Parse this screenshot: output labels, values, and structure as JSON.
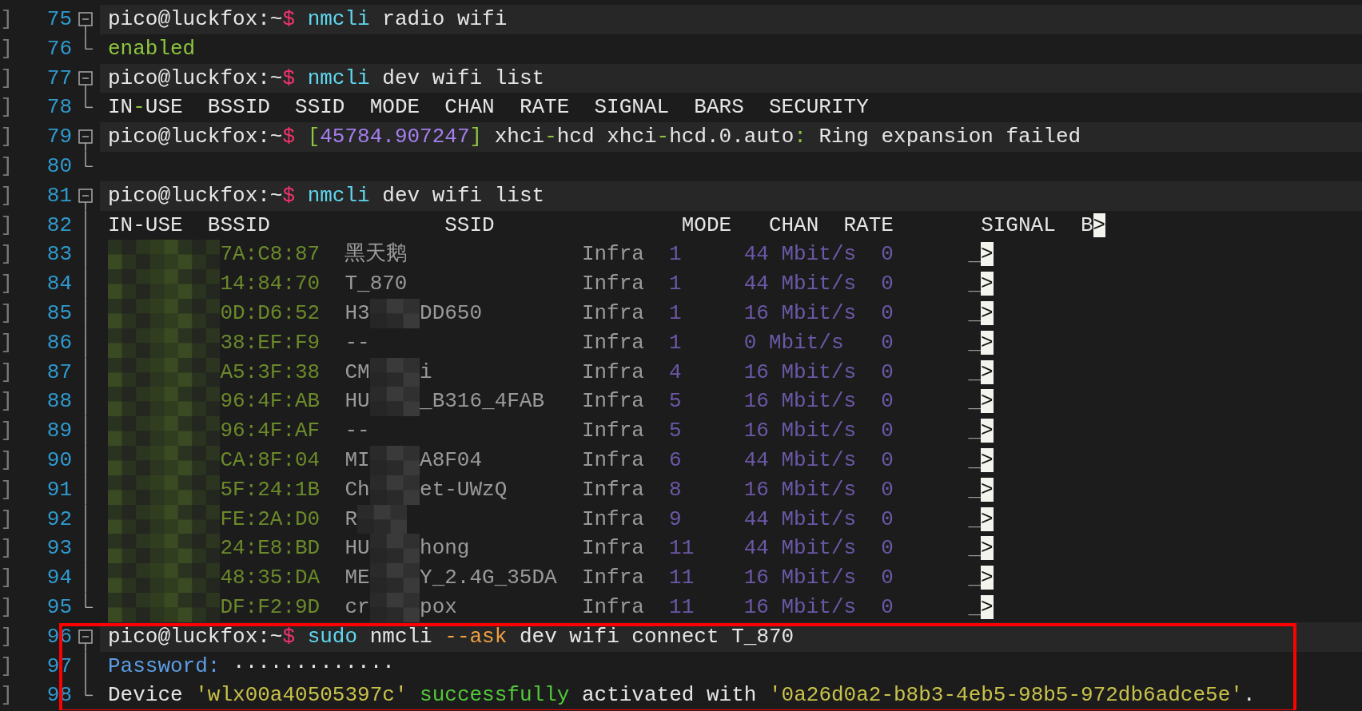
{
  "lines": [
    {
      "number": "75",
      "gutter": "]",
      "fold": {
        "kind": "start"
      },
      "kind": "command",
      "segments": [
        {
          "text": "pico@luckfox:~",
          "kind": "prompt"
        },
        {
          "text": "$",
          "kind": "dollar",
          "join": true
        },
        {
          "text": "nmcli",
          "kind": "cmd"
        },
        {
          "text": "radio wifi",
          "kind": "plain"
        }
      ]
    },
    {
      "number": "76",
      "gutter": "]",
      "fold": {
        "kind": "end"
      },
      "kind": "output",
      "segments": [
        {
          "text": "enabled",
          "kind": "green"
        }
      ]
    },
    {
      "number": "77",
      "gutter": "]",
      "fold": {
        "kind": "start"
      },
      "kind": "command",
      "segments": [
        {
          "text": "pico@luckfox:~",
          "kind": "prompt"
        },
        {
          "text": "$",
          "kind": "dollar",
          "join": true
        },
        {
          "text": "nmcli",
          "kind": "cmd"
        },
        {
          "text": "dev wifi list",
          "kind": "plain"
        }
      ]
    },
    {
      "number": "78",
      "gutter": "]",
      "fold": {
        "kind": "end"
      },
      "kind": "output",
      "segments": [
        {
          "text": "IN",
          "kind": "plain"
        },
        {
          "text": "-",
          "kind": "green",
          "join": true
        },
        {
          "text": "USE  BSSID  SSID  MODE  CHAN  RATE  SIGNAL  BARS  SECURITY",
          "kind": "plain",
          "join": true
        }
      ]
    },
    {
      "number": "79",
      "gutter": "]",
      "fold": {
        "kind": "start"
      },
      "kind": "command",
      "segments": [
        {
          "text": "pico@luckfox:~",
          "kind": "prompt"
        },
        {
          "text": "$",
          "kind": "dollar",
          "join": true
        },
        {
          "text": "[",
          "kind": "green"
        },
        {
          "text": "45784.907247",
          "kind": "number",
          "join": true
        },
        {
          "text": "]",
          "kind": "green",
          "join": true
        },
        {
          "text": "xhci",
          "kind": "plain"
        },
        {
          "text": "-",
          "kind": "green",
          "join": true
        },
        {
          "text": "hcd",
          "kind": "plain",
          "join": true
        },
        {
          "text": "xhci",
          "kind": "plain"
        },
        {
          "text": "-",
          "kind": "green",
          "join": true
        },
        {
          "text": "hcd.0.auto",
          "kind": "plain",
          "join": true
        },
        {
          "text": ":",
          "kind": "green",
          "join": true
        },
        {
          "text": "Ring expansion failed",
          "kind": "plain"
        }
      ]
    },
    {
      "number": "80",
      "gutter": "]",
      "fold": {
        "kind": "end"
      },
      "kind": "blank"
    },
    {
      "number": "81",
      "gutter": "]",
      "fold": {
        "kind": "start"
      },
      "kind": "command",
      "segments": [
        {
          "text": "pico@luckfox:~",
          "kind": "prompt"
        },
        {
          "text": "$",
          "kind": "dollar",
          "join": true
        },
        {
          "text": "nmcli",
          "kind": "cmd"
        },
        {
          "text": "dev wifi list",
          "kind": "plain"
        }
      ]
    },
    {
      "number": "82",
      "gutter": "]",
      "fold": {
        "kind": "middle"
      },
      "kind": "header",
      "cells": [
        "IN-USE",
        "BSSID",
        "SSID",
        "MODE",
        "CHAN",
        "RATE",
        "SIGNAL",
        "B"
      ],
      "more": ">"
    },
    {
      "number": "83",
      "gutter": "]",
      "fold": {
        "kind": "middle"
      },
      "kind": "network",
      "bssid": "7A:C8:87",
      "ssid": {
        "head": "黑天鹅",
        "redacted": false
      },
      "mode": "Infra",
      "chan": "1",
      "rate": "44 Mbit/s",
      "signal": "0",
      "bars": "_",
      "more": ">"
    },
    {
      "number": "84",
      "gutter": "]",
      "fold": {
        "kind": "middle"
      },
      "kind": "network",
      "bssid": "14:84:70",
      "ssid": {
        "head": "T_870",
        "redacted": false
      },
      "mode": "Infra",
      "chan": "1",
      "rate": "44 Mbit/s",
      "signal": "0",
      "bars": "_",
      "more": ">"
    },
    {
      "number": "85",
      "gutter": "]",
      "fold": {
        "kind": "middle"
      },
      "kind": "network",
      "bssid": "0D:D6:52",
      "ssid": {
        "head": "H3",
        "tail": "DD650",
        "redacted": true
      },
      "mode": "Infra",
      "chan": "1",
      "rate": "16 Mbit/s",
      "signal": "0",
      "bars": "_",
      "more": ">"
    },
    {
      "number": "86",
      "gutter": "]",
      "fold": {
        "kind": "middle"
      },
      "kind": "network",
      "bssid": "38:EF:F9",
      "ssid": {
        "head": "--",
        "redacted": false
      },
      "mode": "Infra",
      "chan": "1",
      "rate": "0 Mbit/s",
      "signal": "0",
      "bars": "_",
      "more": ">"
    },
    {
      "number": "87",
      "gutter": "]",
      "fold": {
        "kind": "middle"
      },
      "kind": "network",
      "bssid": "A5:3F:38",
      "ssid": {
        "head": "CM",
        "tail": "i",
        "redacted": true
      },
      "mode": "Infra",
      "chan": "4",
      "rate": "16 Mbit/s",
      "signal": "0",
      "bars": "_",
      "more": ">"
    },
    {
      "number": "88",
      "gutter": "]",
      "fold": {
        "kind": "middle"
      },
      "kind": "network",
      "bssid": "96:4F:AB",
      "ssid": {
        "head": "HU",
        "tail": "_B316_4FAB",
        "redacted": true
      },
      "mode": "Infra",
      "chan": "5",
      "rate": "16 Mbit/s",
      "signal": "0",
      "bars": "_",
      "more": ">"
    },
    {
      "number": "89",
      "gutter": "]",
      "fold": {
        "kind": "middle"
      },
      "kind": "network",
      "bssid": "96:4F:AF",
      "ssid": {
        "head": "--",
        "redacted": false
      },
      "mode": "Infra",
      "chan": "5",
      "rate": "16 Mbit/s",
      "signal": "0",
      "bars": "_",
      "more": ">"
    },
    {
      "number": "90",
      "gutter": "]",
      "fold": {
        "kind": "middle"
      },
      "kind": "network",
      "bssid": "CA:8F:04",
      "ssid": {
        "head": "MI",
        "tail": "A8F04",
        "redacted": true
      },
      "mode": "Infra",
      "chan": "6",
      "rate": "44 Mbit/s",
      "signal": "0",
      "bars": "_",
      "more": ">"
    },
    {
      "number": "91",
      "gutter": "]",
      "fold": {
        "kind": "middle"
      },
      "kind": "network",
      "bssid": "5F:24:1B",
      "ssid": {
        "head": "Ch",
        "tail": "et-UWzQ",
        "redacted": true
      },
      "mode": "Infra",
      "chan": "8",
      "rate": "16 Mbit/s",
      "signal": "0",
      "bars": "_",
      "more": ">"
    },
    {
      "number": "92",
      "gutter": "]",
      "fold": {
        "kind": "middle"
      },
      "kind": "network",
      "bssid": "FE:2A:D0",
      "ssid": {
        "head": "R",
        "redacted": true
      },
      "mode": "Infra",
      "chan": "9",
      "rate": "44 Mbit/s",
      "signal": "0",
      "bars": "_",
      "more": ">"
    },
    {
      "number": "93",
      "gutter": "]",
      "fold": {
        "kind": "middle"
      },
      "kind": "network",
      "bssid": "24:E8:BD",
      "ssid": {
        "head": "HU",
        "tail": "hong",
        "redacted": true
      },
      "mode": "Infra",
      "chan": "11",
      "rate": "44 Mbit/s",
      "signal": "0",
      "bars": "_",
      "more": ">"
    },
    {
      "number": "94",
      "gutter": "]",
      "fold": {
        "kind": "middle"
      },
      "kind": "network",
      "bssid": "48:35:DA",
      "ssid": {
        "head": "ME",
        "tail": "Y_2.4G_35DA",
        "redacted": true
      },
      "mode": "Infra",
      "chan": "11",
      "rate": "16 Mbit/s",
      "signal": "0",
      "bars": "_",
      "more": ">"
    },
    {
      "number": "95",
      "gutter": "]",
      "fold": {
        "kind": "end"
      },
      "kind": "network",
      "bssid": "DF:F2:9D",
      "ssid": {
        "head": "cr",
        "tail": "pox",
        "redacted": true
      },
      "mode": "Infra",
      "chan": "11",
      "rate": "16 Mbit/s",
      "signal": "0",
      "bars": "_",
      "more": ">"
    },
    {
      "number": "96",
      "gutter": "]",
      "fold": {
        "kind": "start"
      },
      "kind": "command",
      "boxed": true,
      "segments": [
        {
          "text": "pico@luckfox:~",
          "kind": "prompt"
        },
        {
          "text": "$",
          "kind": "dollar",
          "join": true
        },
        {
          "text": "sudo",
          "kind": "cmd"
        },
        {
          "text": "nmcli",
          "kind": "plain"
        },
        {
          "text": "--ask",
          "kind": "flag"
        },
        {
          "text": "dev wifi connect T_870",
          "kind": "plain"
        }
      ]
    },
    {
      "number": "97",
      "gutter": "]",
      "fold": {
        "kind": "middle"
      },
      "kind": "output",
      "boxed": true,
      "segments": [
        {
          "text": "Password:",
          "kind": "label"
        },
        {
          "text": "·············",
          "kind": "plain"
        }
      ]
    },
    {
      "number": "98",
      "gutter": "]",
      "fold": {
        "kind": "end"
      },
      "kind": "output",
      "boxed": true,
      "segments": [
        {
          "text": "Device",
          "kind": "plain"
        },
        {
          "text": "'wlx00a40505397c'",
          "kind": "quoted"
        },
        {
          "text": "successfully",
          "kind": "success"
        },
        {
          "text": "activated with",
          "kind": "plain"
        },
        {
          "text": "'0a26d0a2-b8b3-4eb5-98b5-972db6adce5e'",
          "kind": "quoted"
        },
        {
          "text": ".",
          "kind": "plain",
          "join": true
        }
      ]
    }
  ],
  "highlight": {
    "color": "#ff0000"
  }
}
